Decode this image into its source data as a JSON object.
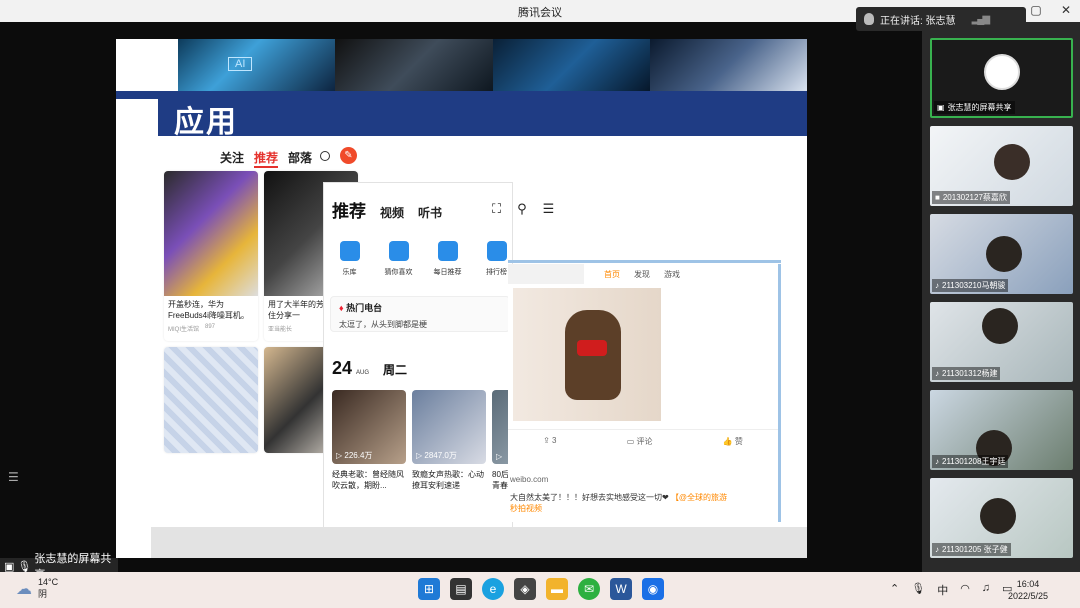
{
  "window": {
    "title": "腾讯会议",
    "buttons": [
      "—",
      "▢",
      "✕"
    ]
  },
  "speaker": {
    "label": "正在讲话: 张志慧"
  },
  "slide": {
    "title": "应用",
    "ai_tag": "AI",
    "phone_tabs": [
      "关注",
      "推荐",
      "部落"
    ],
    "pen_glyph": "✎",
    "cards": [
      {
        "caption": "开盖秒连，华为FreeBuds4i降噪耳机。",
        "author": "MIQI生活馆",
        "views": "897"
      },
      {
        "caption": "用了大半年的芳在忍不住分享一",
        "author": "亚当能长",
        "views": ""
      },
      {
        "caption": "",
        "author": "",
        "views": ""
      },
      {
        "caption": "",
        "author": "",
        "views": ""
      }
    ],
    "music": {
      "tab_main": "推荐",
      "tab2": "视频",
      "tab3": "听书",
      "icons": [
        "⛶",
        "⚲",
        "☰"
      ],
      "grid": [
        "乐库",
        "猜你喜欢",
        "每日推荐",
        "排行榜"
      ],
      "hot_title": "热门电台",
      "hot_line": "太逗了，从头到脚都是梗",
      "date_day": "24",
      "date_month": "AUG",
      "weekday": "周二",
      "songs": [
        {
          "count": "▷ 226.4万",
          "caption": "经典老歌：曾经随风吹云散，期盼..."
        },
        {
          "count": "▷ 2847.0万",
          "caption": "致瘾女声热歌：心动撩耳安利速递"
        },
        {
          "count": "▷",
          "caption": "80后青春"
        }
      ]
    },
    "weibo": {
      "nav": [
        "首页",
        "发现",
        "游戏"
      ],
      "actions": [
        "⇪ 3",
        "▭ 评论",
        "👍 赞"
      ],
      "source": "weibo.com",
      "post": "大自然太美了！！！好想去实地感受这一切❤",
      "post_link": "【@全球的旅游",
      "post_link2": "秒拍视频"
    }
  },
  "share_label": "张志慧的屏幕共享",
  "participants": [
    {
      "name": "张志慧的屏幕共享",
      "active": true
    },
    {
      "name": "201302127蔡嘉欣",
      "active": false
    },
    {
      "name": "211303210马朝骏",
      "active": false
    },
    {
      "name": "211301312杨建",
      "active": false
    },
    {
      "name": "211301208王宇廷",
      "active": false
    },
    {
      "name": "211301205 张子健",
      "active": false
    }
  ],
  "taskbar": {
    "weather_temp": "14°C",
    "weather_cond": "阴",
    "ime": "中",
    "time": "16:04",
    "date": "2022/5/25"
  }
}
